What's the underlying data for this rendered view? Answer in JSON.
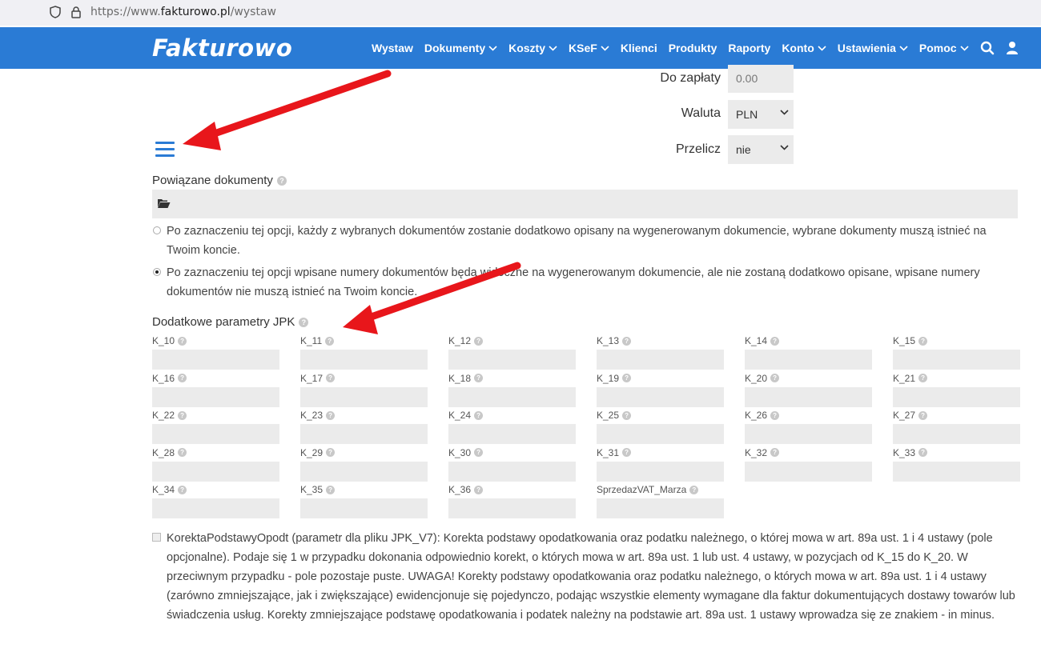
{
  "browser": {
    "url_prefix": "https://www.",
    "url_domain": "fakturowo.pl",
    "url_path": "/wystaw"
  },
  "navbar": {
    "logo": "Fakturowo",
    "bg_color": "#2a7bd5",
    "items": [
      {
        "label": "Wystaw",
        "dropdown": false
      },
      {
        "label": "Dokumenty",
        "dropdown": true
      },
      {
        "label": "Koszty",
        "dropdown": true
      },
      {
        "label": "KSeF",
        "dropdown": true
      },
      {
        "label": "Klienci",
        "dropdown": false
      },
      {
        "label": "Produkty",
        "dropdown": false
      },
      {
        "label": "Raporty",
        "dropdown": false
      },
      {
        "label": "Konto",
        "dropdown": true
      },
      {
        "label": "Ustawienia",
        "dropdown": true
      },
      {
        "label": "Pomoc",
        "dropdown": true
      }
    ],
    "icons": [
      "search-icon",
      "user-icon"
    ]
  },
  "totals": {
    "do_zaplaty_label": "Do zapłaty",
    "do_zaplaty_value": "0.00",
    "waluta_label": "Waluta",
    "waluta_value": "PLN",
    "przelicz_label": "Przelicz",
    "przelicz_value": "nie"
  },
  "related": {
    "label": "Powiązane dokumenty",
    "option1": "Po zaznaczeniu tej opcji, każdy z wybranych dokumentów zostanie dodatkowo opisany na wygenerowanym dokumencie, wybrane dokumenty muszą istnieć na Twoim koncie.",
    "option2": "Po zaznaczeniu tej opcji wpisane numery dokumentów będą widoczne na wygenerowanym dokumencie, ale nie zostaną dodatkowo opisane, wpisane numery dokumentów nie muszą istnieć na Twoim koncie.",
    "selected": 2
  },
  "jpk": {
    "label": "Dodatkowe parametry JPK",
    "fields": [
      "K_10",
      "K_11",
      "K_12",
      "K_13",
      "K_14",
      "K_15",
      "K_16",
      "K_17",
      "K_18",
      "K_19",
      "K_20",
      "K_21",
      "K_22",
      "K_23",
      "K_24",
      "K_25",
      "K_26",
      "K_27",
      "K_28",
      "K_29",
      "K_30",
      "K_31",
      "K_32",
      "K_33",
      "K_34",
      "K_35",
      "K_36",
      "SprzedazVAT_Marza"
    ]
  },
  "korekta": {
    "text": "KorektaPodstawyOpodt (parametr dla pliku JPK_V7): Korekta podstawy opodatkowania oraz podatku należnego, o której mowa w art. 89a ust. 1 i 4 ustawy (pole opcjonalne). Podaje się 1 w przypadku dokonania odpowiednio korekt, o których mowa w art. 89a ust. 1 lub ust. 4 ustawy, w pozycjach od K_15 do K_20. W przeciwnym przypadku - pole pozostaje puste. UWAGA! Korekty podstawy opodatkowania oraz podatku należnego, o których mowa w art. 89a ust. 1 i 4 ustawy (zarówno zmniejszające, jak i zwiększające) ewidencjonuje się pojedynczo, podając wszystkie elementy wymagane dla faktur dokumentujących dostawy towarów lub świadczenia usług. Korekty zmniejszające podstawę opodatkowania i podatek należny na podstawie art. 89a ust. 1 ustawy wprowadza się ze znakiem - in minus.",
    "checked": false
  },
  "annotation_color": "#e8161b"
}
